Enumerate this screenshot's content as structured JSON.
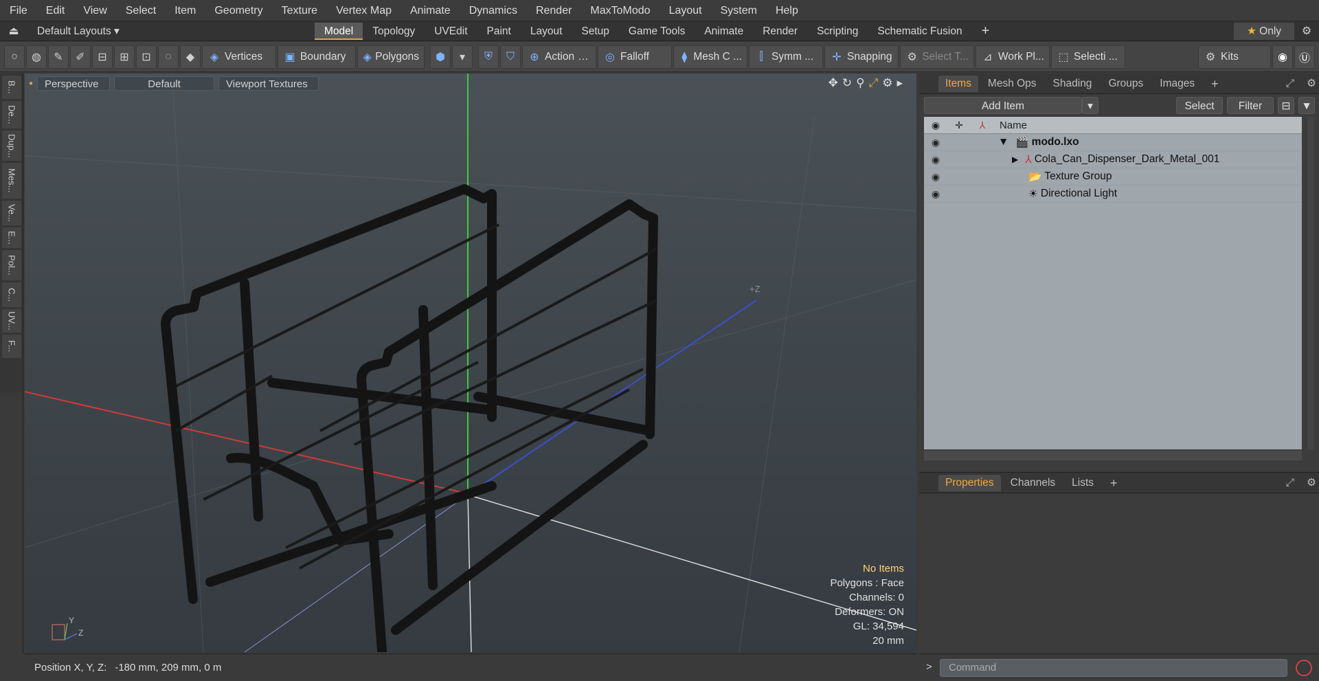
{
  "menubar": {
    "items": [
      "File",
      "Edit",
      "View",
      "Select",
      "Item",
      "Geometry",
      "Texture",
      "Vertex Map",
      "Animate",
      "Dynamics",
      "Render",
      "MaxToModo",
      "Layout",
      "System",
      "Help"
    ]
  },
  "layoutbar": {
    "layouts": "Default Layouts",
    "tabs": [
      "Model",
      "Topology",
      "UVEdit",
      "Paint",
      "Layout",
      "Setup",
      "Game Tools",
      "Animate",
      "Render",
      "Scripting",
      "Schematic Fusion"
    ],
    "active": "Model",
    "only": "Only"
  },
  "toolbar": {
    "vertices": "Vertices",
    "boundary": "Boundary",
    "polygons": "Polygons",
    "action": "Action",
    "falloff": "Falloff",
    "mesh": "Mesh C ...",
    "symm": "Symm ...",
    "snapping": "Snapping",
    "select_t": "Select T...",
    "workplane": "Work Pl...",
    "selection": "Selecti ...",
    "kits": "Kits"
  },
  "lefttabs": [
    "B...",
    "De...",
    "Dup...",
    "Mes...",
    "Ve...",
    "E...",
    "Pol...",
    "C...",
    "UV...",
    "F..."
  ],
  "viewport": {
    "view": "Perspective",
    "shading": "Default",
    "textures": "Viewport Textures",
    "axis_label": "+Z",
    "info": {
      "items": "No Items",
      "polygons": "Polygons : Face",
      "channels": "Channels: 0",
      "deformers": "Deformers: ON",
      "gl": "GL: 34,594",
      "scale": "20 mm"
    }
  },
  "status": {
    "label": "Position X, Y, Z:",
    "value": "-180 mm, 209 mm, 0 m"
  },
  "items_panel": {
    "tabs": [
      "Items",
      "Mesh Ops",
      "Shading",
      "Groups",
      "Images"
    ],
    "active": "Items",
    "add_item": "Add Item",
    "select": "Select",
    "filter": "Filter",
    "name_header": "Name",
    "rows": [
      {
        "name": "modo.lxo"
      },
      {
        "name": "Cola_Can_Dispenser_Dark_Metal_001"
      },
      {
        "name": "Texture Group"
      },
      {
        "name": "Directional Light"
      }
    ]
  },
  "props_panel": {
    "tabs": [
      "Properties",
      "Channels",
      "Lists"
    ],
    "active": "Properties"
  },
  "command": {
    "placeholder": "Command"
  },
  "colors": {
    "accent": "#e6a23c",
    "x_axis": "#d03a3a",
    "y_axis": "#3ccd3c",
    "z_axis": "#3a4fd0"
  }
}
